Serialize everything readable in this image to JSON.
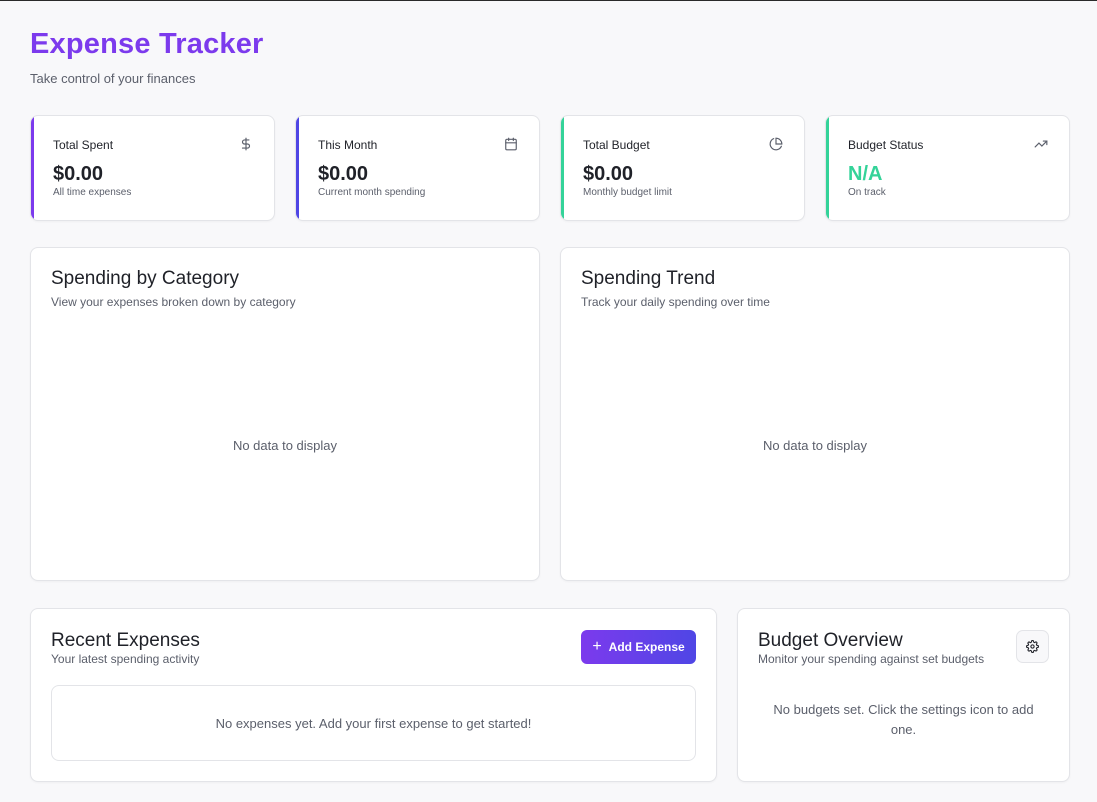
{
  "header": {
    "title": "Expense Tracker",
    "subtitle": "Take control of your finances"
  },
  "stats": [
    {
      "label": "Total Spent",
      "value": "$0.00",
      "note": "All time expenses",
      "icon": "dollar-icon",
      "accent": "#7c3aed",
      "value_color": "#1f2128"
    },
    {
      "label": "This Month",
      "value": "$0.00",
      "note": "Current month spending",
      "icon": "calendar-icon",
      "accent": "#4f46e5",
      "value_color": "#1f2128"
    },
    {
      "label": "Total Budget",
      "value": "$0.00",
      "note": "Monthly budget limit",
      "icon": "pie-chart-icon",
      "accent": "#34d399",
      "value_color": "#1f2128"
    },
    {
      "label": "Budget Status",
      "value": "N/A",
      "note": "On track",
      "icon": "trending-up-icon",
      "accent": "#34d399",
      "value_color": "#34d399"
    }
  ],
  "category_panel": {
    "title": "Spending by Category",
    "subtitle": "View your expenses broken down by category",
    "empty": "No data to display"
  },
  "trend_panel": {
    "title": "Spending Trend",
    "subtitle": "Track your daily spending over time",
    "empty": "No data to display"
  },
  "recent_panel": {
    "title": "Recent Expenses",
    "subtitle": "Your latest spending activity",
    "add_label": "Add Expense",
    "empty": "No expenses yet. Add your first expense to get started!"
  },
  "budget_panel": {
    "title": "Budget Overview",
    "subtitle": "Monitor your spending against set budgets",
    "empty": "No budgets set. Click the settings icon to add one."
  },
  "colors": {
    "brand": "#7c3aed",
    "indigo": "#4f46e5",
    "success": "#34d399"
  }
}
